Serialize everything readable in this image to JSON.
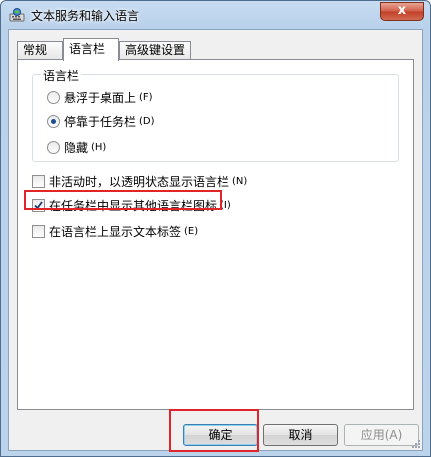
{
  "window": {
    "title": "文本服务和输入语言",
    "close_glyph": "x",
    "icon": "keyboard-globe-icon"
  },
  "tabs": [
    {
      "label": "常规",
      "active": false
    },
    {
      "label": "语言栏",
      "active": true
    },
    {
      "label": "高级键设置",
      "active": false
    }
  ],
  "language_bar_group": {
    "legend": "语言栏",
    "options": [
      {
        "label": "悬浮于桌面上",
        "hotkey": "(F)",
        "selected": false
      },
      {
        "label": "停靠于任务栏",
        "hotkey": "(D)",
        "selected": true
      },
      {
        "label": "隐藏",
        "hotkey": "(H)",
        "selected": false
      }
    ]
  },
  "checkboxes": [
    {
      "label": "非活动时，以透明状态显示语言栏",
      "hotkey": "(N)",
      "checked": false
    },
    {
      "label": "在任务栏中显示其他语言栏图标",
      "hotkey": "(I)",
      "checked": true
    },
    {
      "label": "在语言栏上显示文本标签",
      "hotkey": "(E)",
      "checked": false
    }
  ],
  "buttons": {
    "ok": "确定",
    "cancel": "取消",
    "apply": "应用(A)"
  },
  "colors": {
    "highlight": "#e0242a",
    "title_gradient": "#b9d1ea"
  }
}
